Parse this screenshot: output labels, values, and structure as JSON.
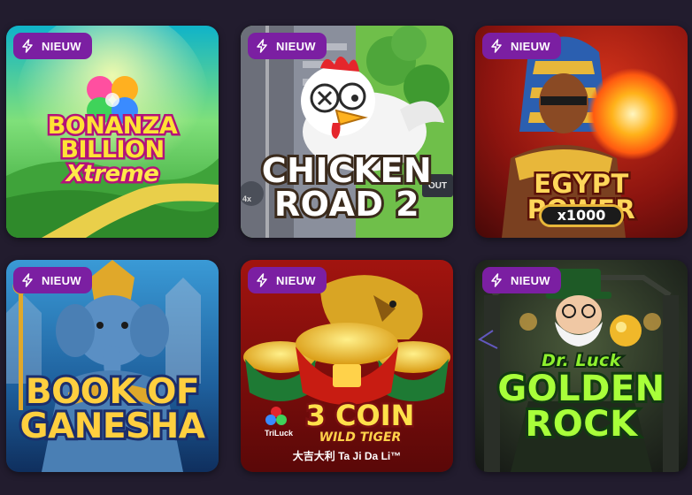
{
  "badge_label": "NIEUW",
  "badge_icon": "lightning-icon",
  "colors": {
    "background": "#221c2e",
    "badge": "#7b1fa2"
  },
  "games": [
    {
      "title_line1": "BONANZA",
      "title_line2": "BILLION",
      "title_line3": "Xtreme"
    },
    {
      "title_line1": "CHICKEN",
      "title_line2": "ROAD 2",
      "side_label": "OUT",
      "multiplier_label": "4x"
    },
    {
      "title_line1": "EGYPT POWER",
      "title_line2": "x1000"
    },
    {
      "title_line1": "BOOK OF",
      "title_line2": "GANESHA"
    },
    {
      "brand": "TriLuck",
      "title_line1": "3 COIN",
      "title_line2": "WILD TIGER",
      "title_line3": "大吉大利 Ta Ji Da Li™"
    },
    {
      "title_line1": "Dr. Luck",
      "title_line2": "GOLDEN",
      "title_line3": "ROCK"
    }
  ]
}
